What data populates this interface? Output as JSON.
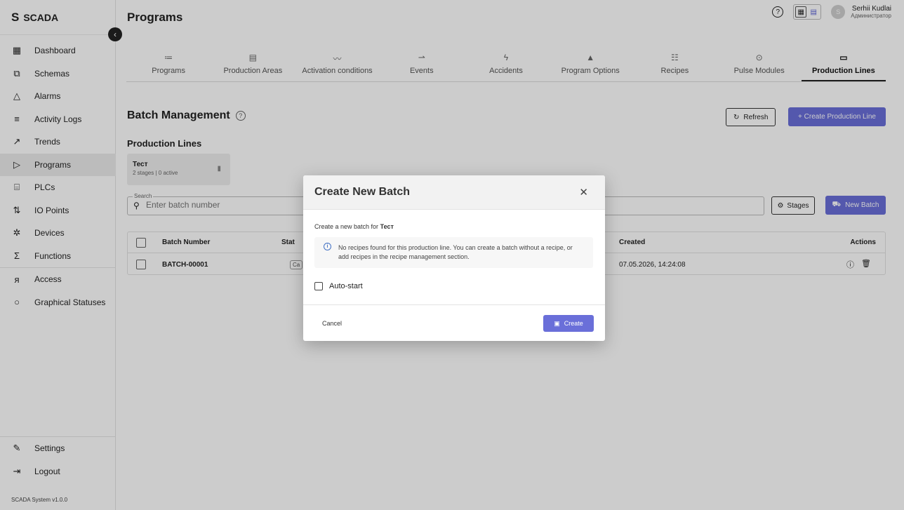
{
  "brand": {
    "letter": "S",
    "name": "SCADA"
  },
  "sidebar": {
    "items": [
      {
        "label": "Dashboard",
        "icon": "dashboard-icon"
      },
      {
        "label": "Schemas",
        "icon": "schema-icon"
      },
      {
        "label": "Alarms",
        "icon": "bell-icon"
      },
      {
        "label": "Activity Logs",
        "icon": "list-icon"
      },
      {
        "label": "Trends",
        "icon": "trend-icon"
      },
      {
        "label": "Programs",
        "icon": "play-icon",
        "active": true
      },
      {
        "label": "PLCs",
        "icon": "plc-icon"
      },
      {
        "label": "IO Points",
        "icon": "io-icon"
      },
      {
        "label": "Devices",
        "icon": "chip-icon"
      },
      {
        "label": "Functions",
        "icon": "sigma-icon"
      },
      {
        "label": "Access",
        "icon": "users-icon"
      },
      {
        "label": "Graphical Statuses",
        "icon": "circle-icon"
      }
    ],
    "bottom": [
      {
        "label": "Settings",
        "icon": "wrench-icon"
      },
      {
        "label": "Logout",
        "icon": "logout-icon"
      }
    ],
    "version": "SCADA System v1.0.0"
  },
  "header": {
    "title": "Programs",
    "user": {
      "name": "Serhii Kudlai",
      "role": "Администратор",
      "initial": "S"
    }
  },
  "tabs": [
    {
      "label": "Programs",
      "icon": "≔"
    },
    {
      "label": "Production Areas",
      "icon": "▤"
    },
    {
      "label": "Activation conditions",
      "icon": "〰"
    },
    {
      "label": "Events",
      "icon": "⇀"
    },
    {
      "label": "Accidents",
      "icon": "ϟ"
    },
    {
      "label": "Program Options",
      "icon": "▲"
    },
    {
      "label": "Recipes",
      "icon": "☷"
    },
    {
      "label": "Pulse Modules",
      "icon": "⊙"
    },
    {
      "label": "Production Lines",
      "icon": "▭",
      "active": true
    }
  ],
  "batch": {
    "title": "Batch Management",
    "refresh_label": "Refresh",
    "create_line_label": "+ Create Production Line",
    "lines_title": "Production Lines",
    "line_card": {
      "name": "Тест",
      "meta": "2 stages | 0 active"
    },
    "search": {
      "label": "Search",
      "placeholder": "Enter batch number"
    },
    "stages_label": "Stages",
    "new_batch_label": "New Batch",
    "columns": {
      "number": "Batch Number",
      "status": "Stat",
      "created": "Created",
      "actions": "Actions"
    },
    "rows": [
      {
        "number": "BATCH-00001",
        "status": "Ca",
        "created": "07.05.2026, 14:24:08"
      }
    ]
  },
  "modal": {
    "title": "Create New Batch",
    "desc_prefix": "Create a new batch for",
    "desc_line": "Тест",
    "info": "No recipes found for this production line. You can create a batch without a recipe, or add recipes in the recipe management section.",
    "autostart_label": "Auto-start",
    "cancel_label": "Cancel",
    "create_label": "Create"
  },
  "colors": {
    "accent": "#6a6fd9",
    "active_bg": "#ececec"
  }
}
